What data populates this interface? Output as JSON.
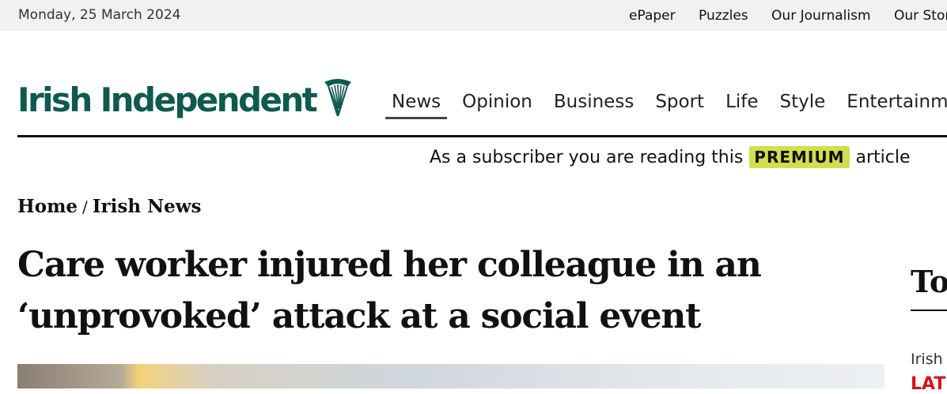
{
  "topbar": {
    "date": "Monday, 25 March 2024",
    "links": [
      "ePaper",
      "Puzzles",
      "Our Journalism",
      "Our Stor"
    ]
  },
  "brand": {
    "name": "Irish Independent",
    "color": "#0e5a4f",
    "icon": "harp-icon"
  },
  "nav": {
    "items": [
      "News",
      "Opinion",
      "Business",
      "Sport",
      "Life",
      "Style",
      "Entertainm"
    ],
    "active": "News"
  },
  "subscriber": {
    "prefix": "As a subscriber you are reading this",
    "badge": "PREMIUM",
    "suffix": "article",
    "badge_color": "#d0de4f"
  },
  "breadcrumb": {
    "home": "Home",
    "separator": "/",
    "section": "Irish News"
  },
  "article": {
    "headline": "Care worker injured her colleague in an ‘unprovoked’ attack at a social event"
  },
  "sidebar": {
    "heading": "To",
    "category": "Irish",
    "latest": "LAT",
    "latest_color": "#d4141c"
  }
}
